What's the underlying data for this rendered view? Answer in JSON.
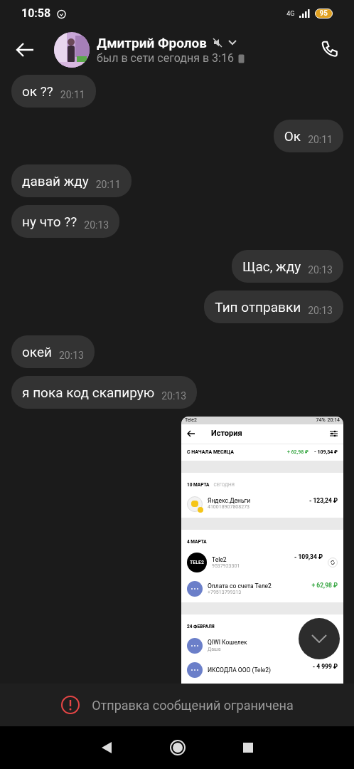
{
  "status_bar": {
    "time": "10:58",
    "network": "4G",
    "battery": "95"
  },
  "header": {
    "name": "Дмитрий Фролов",
    "muted": true,
    "status": "был в сети сегодня в 3:16"
  },
  "messages": [
    {
      "kind": "incoming",
      "text": "ок ??",
      "time": "20:11"
    },
    {
      "kind": "outgoing",
      "text": "Ок",
      "time": "20:11"
    },
    {
      "kind": "incoming",
      "text": "давай жду",
      "time": "20:11"
    },
    {
      "kind": "incoming",
      "text": "ну что ??",
      "time": "20:13"
    },
    {
      "kind": "outgoing",
      "text": "Щас, жду",
      "time": "20:13"
    },
    {
      "kind": "outgoing",
      "text": "Тип отправки",
      "time": "20:13"
    },
    {
      "kind": "incoming",
      "text": "окей",
      "time": "20:13"
    },
    {
      "kind": "incoming",
      "text": "я пока код скапирую",
      "time": "20:13"
    },
    {
      "kind": "screenshot",
      "status_bar": {
        "carrier": "Tele2",
        "battery": "74%",
        "time": "20:14"
      },
      "title": "История",
      "summary": {
        "label": "С НАЧАЛА МЕСЯЦА",
        "income": "+ 62,98 ₽",
        "expense": "- 109,34 ₽"
      },
      "groups": [
        {
          "date": "10 МАРТА",
          "note": "СЕГОДНЯ",
          "items": [
            {
              "kind": "yandex",
              "name": "Яндекс.Деньги",
              "detail": "410018907808273",
              "amount": "- 123,24 ₽",
              "positive": false,
              "repeat": false
            }
          ]
        },
        {
          "date": "4 МАРТА",
          "items": [
            {
              "kind": "tele2",
              "logo": "TELE2",
              "name": "Tele2",
              "detail": "9537923301",
              "amount": "- 109,34 ₽",
              "positive": false,
              "repeat": true
            },
            {
              "kind": "generic",
              "name": "Оплата со счета Теле2",
              "detail": "+79513799313",
              "amount": "+ 62,98 ₽",
              "positive": true,
              "repeat": false
            }
          ]
        },
        {
          "date": "24 ФЕВРАЛЯ",
          "items": [
            {
              "kind": "generic",
              "name": "QIWI Кошелек",
              "detail": "Даша",
              "repeat": false
            },
            {
              "kind": "generic",
              "name": "ИКСОДЛА ООО (Tele2)",
              "amount": "- 4 999 ₽",
              "positive": false,
              "repeat": false
            }
          ]
        }
      ]
    }
  ],
  "notice": {
    "text": "Отправка сообщений ограничена"
  }
}
